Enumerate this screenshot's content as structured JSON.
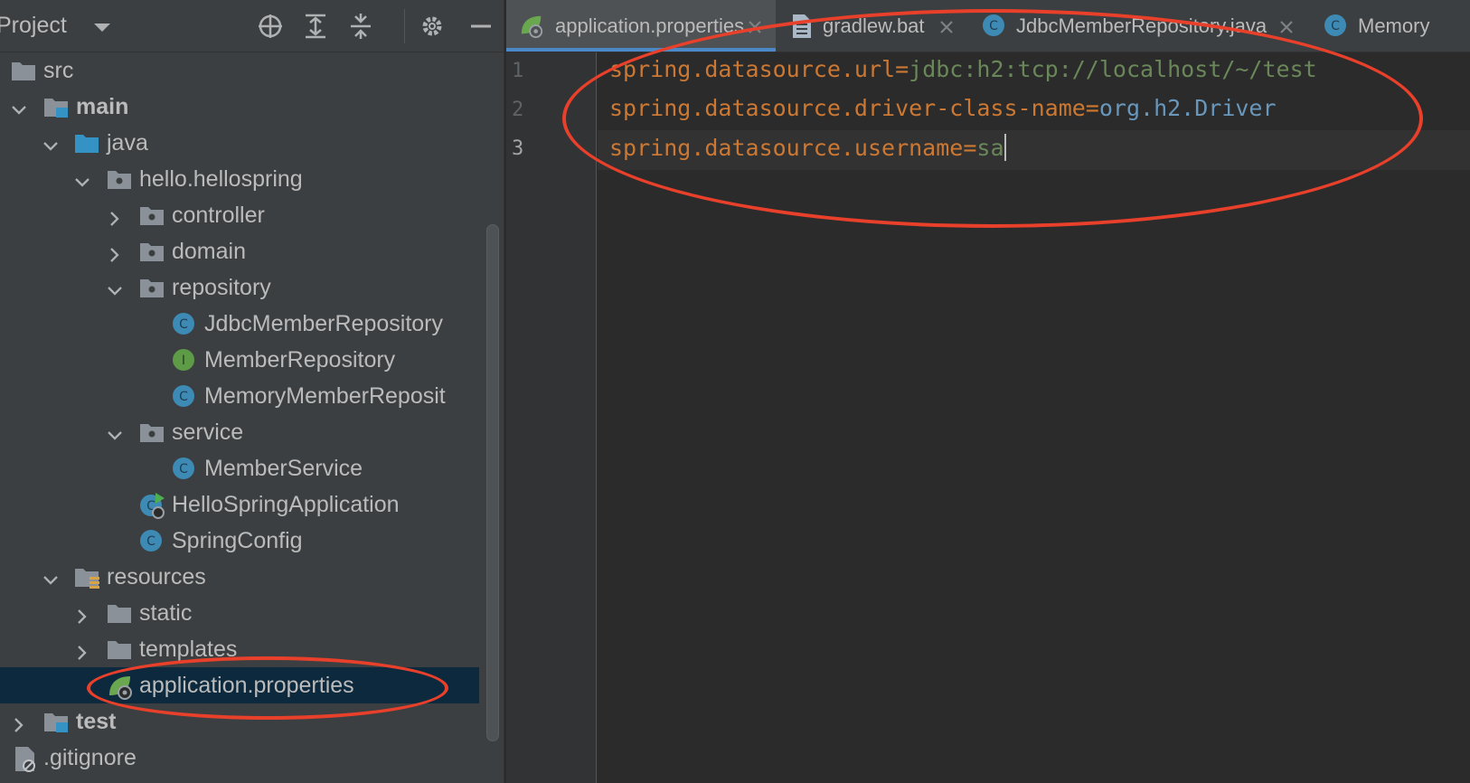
{
  "project_panel": {
    "title": "Project",
    "toolbar": {
      "locate_icon": "crosshair-icon",
      "expand_icon": "expand-all-icon",
      "collapse_icon": "collapse-all-icon",
      "settings_icon": "gear-icon",
      "hide_icon": "minimize-icon"
    },
    "tree": [
      {
        "label": "src",
        "type": "folder",
        "expanded": null
      },
      {
        "label": "main",
        "type": "module-folder",
        "expanded": true
      },
      {
        "label": "java",
        "type": "source-folder",
        "expanded": true
      },
      {
        "label": "hello.hellospring",
        "type": "package",
        "expanded": true
      },
      {
        "label": "controller",
        "type": "package",
        "expanded": false
      },
      {
        "label": "domain",
        "type": "package",
        "expanded": false
      },
      {
        "label": "repository",
        "type": "package",
        "expanded": true
      },
      {
        "label": "JdbcMemberRepository",
        "type": "class"
      },
      {
        "label": "MemberRepository",
        "type": "interface"
      },
      {
        "label": "MemoryMemberReposit",
        "type": "class"
      },
      {
        "label": "service",
        "type": "package",
        "expanded": true
      },
      {
        "label": "MemberService",
        "type": "class"
      },
      {
        "label": "HelloSpringApplication",
        "type": "spring-app"
      },
      {
        "label": "SpringConfig",
        "type": "class"
      },
      {
        "label": "resources",
        "type": "resources-folder",
        "expanded": true
      },
      {
        "label": "static",
        "type": "folder",
        "expanded": false
      },
      {
        "label": "templates",
        "type": "folder",
        "expanded": false
      },
      {
        "label": "application.properties",
        "type": "spring-properties",
        "selected": true
      },
      {
        "label": "test",
        "type": "module-folder",
        "expanded": false
      },
      {
        "label": ".gitignore",
        "type": "ignore-file"
      }
    ]
  },
  "tabs": [
    {
      "label": "application.properties",
      "icon": "spring-properties-icon",
      "active": true
    },
    {
      "label": "gradlew.bat",
      "icon": "text-file-icon",
      "active": false
    },
    {
      "label": "JdbcMemberRepository.java",
      "icon": "class-icon",
      "active": false
    },
    {
      "label": "Memory",
      "icon": "class-icon",
      "active": false
    }
  ],
  "editor": {
    "line_numbers": [
      "1",
      "2",
      "3"
    ],
    "lines": [
      {
        "key": "spring.datasource.url",
        "sep": "=",
        "value": "jdbc:h2:tcp://localhost/~/test"
      },
      {
        "key": "spring.datasource.driver-class-name",
        "sep": "=",
        "value": "org.h2.Driver"
      },
      {
        "key": "spring.datasource.username",
        "sep": "=",
        "value": "sa"
      }
    ]
  },
  "colors": {
    "annotation": "#e8402a",
    "key": "#cc7832",
    "string_value": "#6a8759",
    "class_value": "#6897bb",
    "selection": "#0d293e",
    "tab_accent": "#4a88c7"
  }
}
